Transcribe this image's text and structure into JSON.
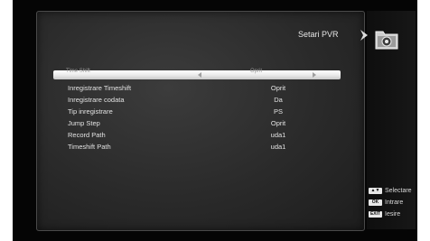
{
  "header": {
    "title": "Setari PVR"
  },
  "icons": {
    "chevron": "chevron-right-icon",
    "folder": "record-folder-icon"
  },
  "menu": {
    "selected": {
      "label": "Time Shift",
      "value": "Oprit"
    },
    "items": [
      {
        "label": "Inregistrare Timeshift",
        "value": "Oprit"
      },
      {
        "label": "Inregistrare codata",
        "value": "Da"
      },
      {
        "label": "Tip inregistrare",
        "value": "PS"
      },
      {
        "label": "Jump Step",
        "value": "Oprit"
      },
      {
        "label": "Record Path",
        "value": "uda1"
      },
      {
        "label": "Timeshift Path",
        "value": "uda1"
      }
    ]
  },
  "hints": [
    {
      "key": "▲▼",
      "label": "Selectare"
    },
    {
      "key": "OK",
      "label": "Intrare"
    },
    {
      "key": "EXIT",
      "label": "Iesire"
    }
  ],
  "colors": {
    "panel": "#2e2e2e",
    "highlight": "#f2f2f2",
    "text": "#e3e3e3"
  }
}
